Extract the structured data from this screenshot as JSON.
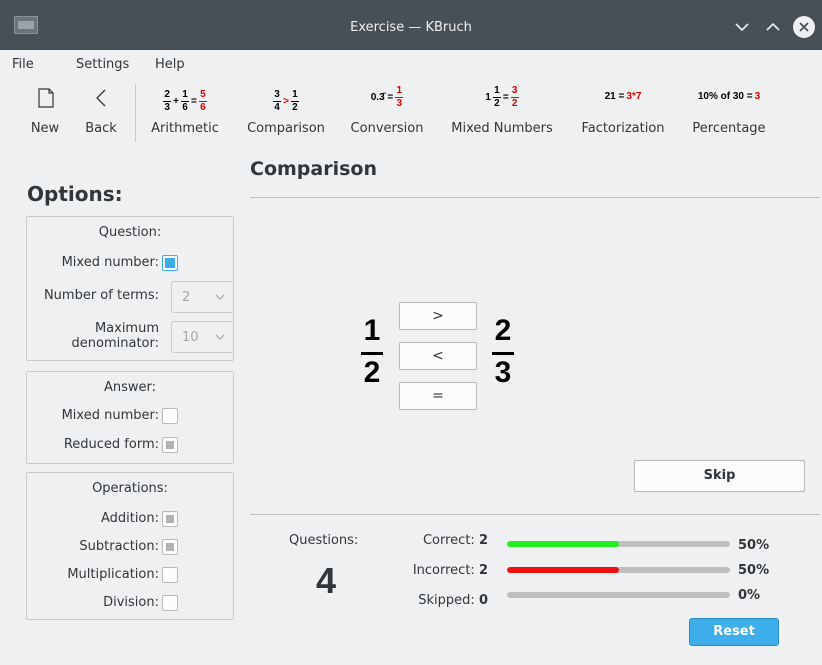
{
  "window": {
    "title": "Exercise — KBruch"
  },
  "menu": {
    "file": "File",
    "settings": "Settings",
    "help": "Help"
  },
  "toolbar": {
    "new": "New",
    "back": "Back",
    "arithmetic": "Arithmetic",
    "comparison": "Comparison",
    "conversion": "Conversion",
    "mixed_numbers": "Mixed Numbers",
    "factorization": "Factorization",
    "percentage": "Percentage",
    "icons": {
      "arithmetic": {
        "a_num": "2",
        "a_den": "3",
        "op": "+",
        "b_num": "1",
        "b_den": "6",
        "eq": "=",
        "r_num": "5",
        "r_den": "6"
      },
      "comparison": {
        "a_num": "3",
        "a_den": "4",
        "op": ">",
        "b_num": "1",
        "b_den": "2"
      },
      "conversion": {
        "left": "0.3̄ =",
        "r_num": "1",
        "r_den": "3"
      },
      "mixed": {
        "whole": "1",
        "a_num": "1",
        "a_den": "2",
        "eq": "=",
        "r_num": "3",
        "r_den": "2"
      },
      "factorization": {
        "left": "21 =",
        "right": "3*7"
      },
      "percentage": {
        "left": "10% of 30 =",
        "right": "3"
      }
    }
  },
  "options": {
    "title": "Options:",
    "question": {
      "title": "Question:",
      "mixed_number": "Mixed number:",
      "number_of_terms": "Number of terms:",
      "number_of_terms_value": "2",
      "max_denominator_line1": "Maximum",
      "max_denominator_line2": "denominator:",
      "max_denominator_value": "10"
    },
    "answer": {
      "title": "Answer:",
      "mixed_number": "Mixed number:",
      "reduced_form": "Reduced form:"
    },
    "operations": {
      "title": "Operations:",
      "addition": "Addition:",
      "subtraction": "Subtraction:",
      "multiplication": "Multiplication:",
      "division": "Division:"
    }
  },
  "main": {
    "title": "Comparison",
    "left_fraction": {
      "num": "1",
      "den": "2"
    },
    "right_fraction": {
      "num": "2",
      "den": "3"
    },
    "buttons": {
      "greater": ">",
      "less": "<",
      "equal": "="
    },
    "skip": "Skip"
  },
  "stats": {
    "questions_label": "Questions:",
    "questions_count": "4",
    "correct_label": "Correct:",
    "correct_count": "2",
    "correct_pct": "50%",
    "correct_fraction": 0.5,
    "incorrect_label": "Incorrect:",
    "incorrect_count": "2",
    "incorrect_pct": "50%",
    "incorrect_fraction": 0.5,
    "skipped_label": "Skipped:",
    "skipped_count": "0",
    "skipped_pct": "0%",
    "skipped_fraction": 0,
    "reset": "Reset",
    "colors": {
      "correct": "#22ee22",
      "incorrect": "#ee1111",
      "accent": "#3daee9"
    }
  }
}
